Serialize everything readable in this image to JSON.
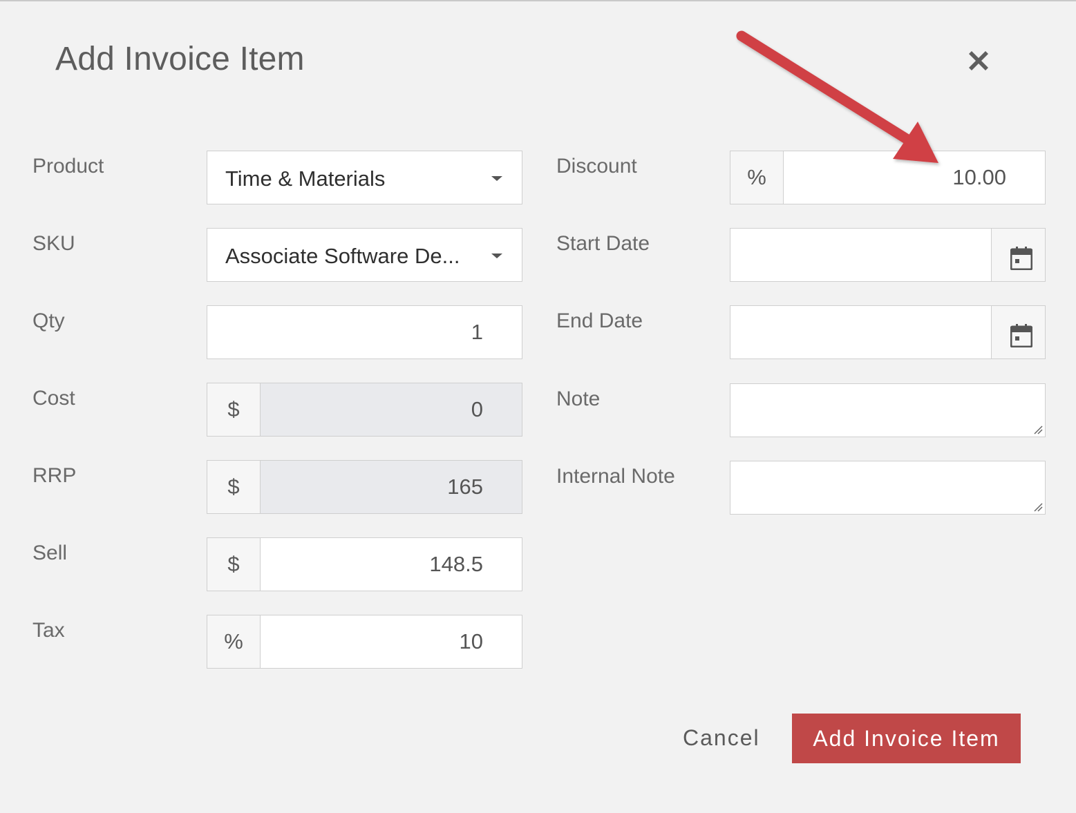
{
  "dialog": {
    "title": "Add Invoice Item",
    "close_icon": "close-x-icon"
  },
  "left_fields": {
    "product": {
      "label": "Product",
      "value": "Time & Materials",
      "icon": "chevron-down-icon"
    },
    "sku": {
      "label": "SKU",
      "value": "Associate Software De...",
      "icon": "chevron-down-icon"
    },
    "qty": {
      "label": "Qty",
      "value": "1"
    },
    "cost": {
      "label": "Cost",
      "prefix": "$",
      "value": "0",
      "readonly": true
    },
    "rrp": {
      "label": "RRP",
      "prefix": "$",
      "value": "165",
      "readonly": true
    },
    "sell": {
      "label": "Sell",
      "prefix": "$",
      "value": "148.5"
    },
    "tax": {
      "label": "Tax",
      "prefix": "%",
      "value": "10"
    }
  },
  "right_fields": {
    "discount": {
      "label": "Discount",
      "prefix": "%",
      "value": "10.00"
    },
    "start_date": {
      "label": "Start Date",
      "value": "",
      "icon": "calendar-icon"
    },
    "end_date": {
      "label": "End Date",
      "value": "",
      "icon": "calendar-icon"
    },
    "note": {
      "label": "Note",
      "value": ""
    },
    "internal_note": {
      "label": "Internal Note",
      "value": ""
    }
  },
  "actions": {
    "cancel_label": "Cancel",
    "submit_label": "Add Invoice Item"
  },
  "colors": {
    "primary": "#c04848",
    "annotation_arrow": "#d04045",
    "background": "#f2f2f2",
    "readonly_bg": "#e9eaed"
  },
  "annotation": {
    "icon": "red-arrow-pointer",
    "target": "discount"
  }
}
